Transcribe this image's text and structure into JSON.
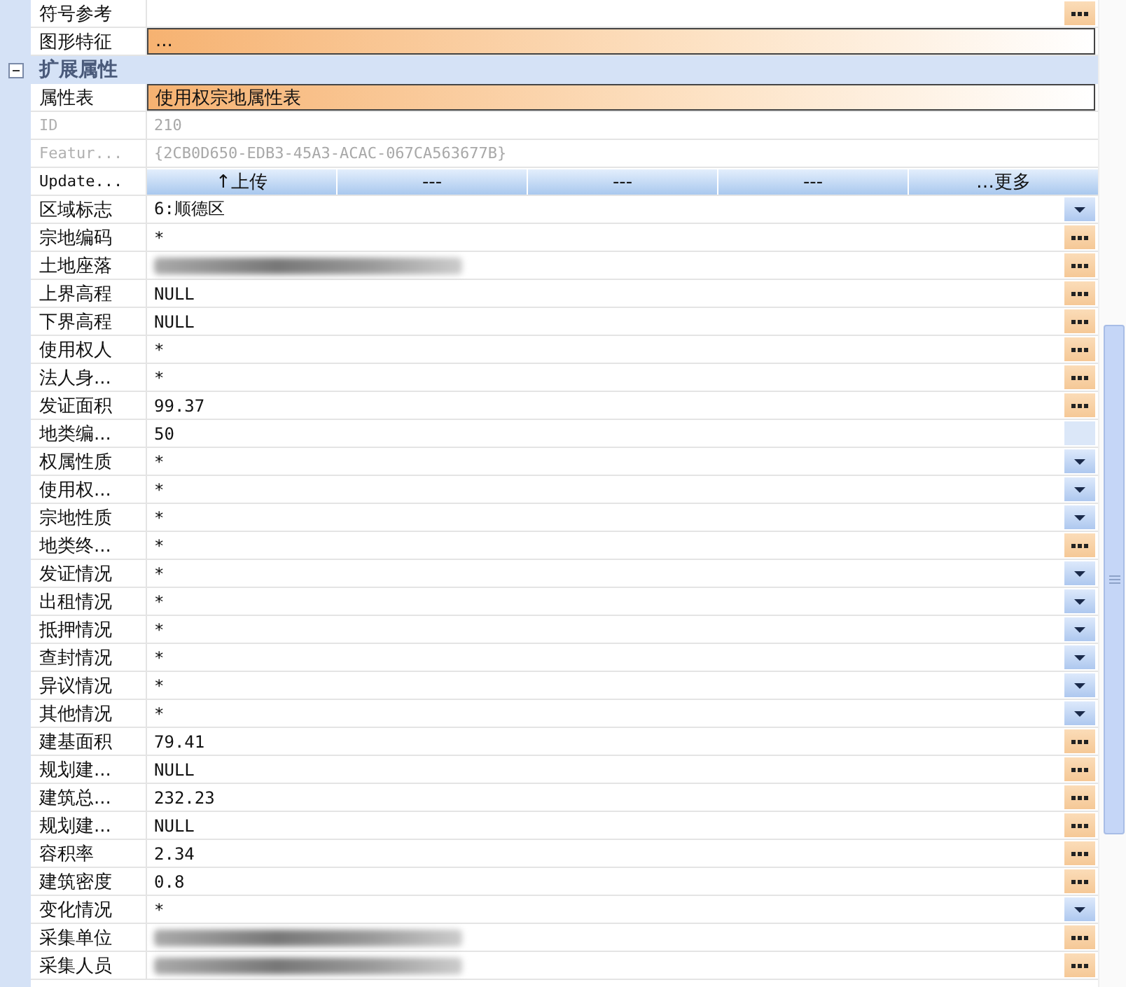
{
  "rows": [
    {
      "kind": "property",
      "name": "符号参考",
      "button": {
        "kind": "ellipsis"
      },
      "selected": false,
      "disabled": false
    },
    {
      "kind": "property",
      "name": "图形特征",
      "value": "...",
      "selected": true,
      "disabled": false
    },
    {
      "kind": "category",
      "name": "扩展属性",
      "expanded": true
    },
    {
      "kind": "property",
      "name": "属性表",
      "value": "使用权宗地属性表",
      "selected": true,
      "disabled": false
    },
    {
      "kind": "property",
      "name": "ID",
      "value": "210",
      "selected": false,
      "disabled": true
    },
    {
      "kind": "property",
      "name": "Featur...",
      "value": "{2CB0D650-EDB3-45A3-ACAC-067CA563677B}",
      "selected": false,
      "disabled": true
    },
    {
      "kind": "buttons",
      "name": "Update...",
      "buttons": [
        "↑上传",
        "---",
        "---",
        "---",
        "…更多"
      ]
    },
    {
      "kind": "property",
      "name": "区域标志",
      "value": "6:顺德区",
      "button": {
        "kind": "dropdown"
      },
      "selected": false,
      "disabled": false
    },
    {
      "kind": "property",
      "name": "宗地编码",
      "value": "*",
      "button": {
        "kind": "ellipsis"
      },
      "selected": false,
      "disabled": false
    },
    {
      "kind": "property",
      "name": "土地座落",
      "redacted": true,
      "button": {
        "kind": "ellipsis"
      },
      "selected": false,
      "disabled": false
    },
    {
      "kind": "property",
      "name": "上界高程",
      "value": "NULL",
      "button": {
        "kind": "ellipsis"
      },
      "selected": false,
      "disabled": false
    },
    {
      "kind": "property",
      "name": "下界高程",
      "value": "NULL",
      "button": {
        "kind": "ellipsis"
      },
      "selected": false,
      "disabled": false
    },
    {
      "kind": "property",
      "name": "使用权人",
      "value": "*",
      "button": {
        "kind": "ellipsis"
      },
      "selected": false,
      "disabled": false
    },
    {
      "kind": "property",
      "name": "法人身...",
      "value": "*",
      "button": {
        "kind": "ellipsis"
      },
      "selected": false,
      "disabled": false
    },
    {
      "kind": "property",
      "name": "发证面积",
      "value": "99.37",
      "button": {
        "kind": "ellipsis"
      },
      "selected": false,
      "disabled": false
    },
    {
      "kind": "property",
      "name": "地类编...",
      "value": "50",
      "button": {
        "kind": "blank"
      },
      "selected": false,
      "disabled": false
    },
    {
      "kind": "property",
      "name": "权属性质",
      "value": "*",
      "button": {
        "kind": "dropdown"
      },
      "selected": false,
      "disabled": false
    },
    {
      "kind": "property",
      "name": "使用权...",
      "value": "*",
      "button": {
        "kind": "dropdown"
      },
      "selected": false,
      "disabled": false
    },
    {
      "kind": "property",
      "name": "宗地性质",
      "value": "*",
      "button": {
        "kind": "dropdown"
      },
      "selected": false,
      "disabled": false
    },
    {
      "kind": "property",
      "name": "地类终...",
      "value": "*",
      "button": {
        "kind": "ellipsis"
      },
      "selected": false,
      "disabled": false
    },
    {
      "kind": "property",
      "name": "发证情况",
      "value": "*",
      "button": {
        "kind": "dropdown"
      },
      "selected": false,
      "disabled": false
    },
    {
      "kind": "property",
      "name": "出租情况",
      "value": "*",
      "button": {
        "kind": "dropdown"
      },
      "selected": false,
      "disabled": false
    },
    {
      "kind": "property",
      "name": "抵押情况",
      "value": "*",
      "button": {
        "kind": "dropdown"
      },
      "selected": false,
      "disabled": false
    },
    {
      "kind": "property",
      "name": "查封情况",
      "value": "*",
      "button": {
        "kind": "dropdown"
      },
      "selected": false,
      "disabled": false
    },
    {
      "kind": "property",
      "name": "异议情况",
      "value": "*",
      "button": {
        "kind": "dropdown"
      },
      "selected": false,
      "disabled": false
    },
    {
      "kind": "property",
      "name": "其他情况",
      "value": "*",
      "button": {
        "kind": "dropdown"
      },
      "selected": false,
      "disabled": false
    },
    {
      "kind": "property",
      "name": "建基面积",
      "value": "79.41",
      "button": {
        "kind": "ellipsis"
      },
      "selected": false,
      "disabled": false
    },
    {
      "kind": "property",
      "name": "规划建...",
      "value": "NULL",
      "button": {
        "kind": "ellipsis"
      },
      "selected": false,
      "disabled": false
    },
    {
      "kind": "property",
      "name": "建筑总...",
      "value": "232.23",
      "button": {
        "kind": "ellipsis"
      },
      "selected": false,
      "disabled": false
    },
    {
      "kind": "property",
      "name": "规划建...",
      "value": "NULL",
      "button": {
        "kind": "ellipsis"
      },
      "selected": false,
      "disabled": false
    },
    {
      "kind": "property",
      "name": "容积率",
      "value": "2.34",
      "button": {
        "kind": "ellipsis"
      },
      "selected": false,
      "disabled": false
    },
    {
      "kind": "property",
      "name": "建筑密度",
      "value": "0.8",
      "button": {
        "kind": "ellipsis"
      },
      "selected": false,
      "disabled": false
    },
    {
      "kind": "property",
      "name": "变化情况",
      "value": "*",
      "button": {
        "kind": "dropdown"
      },
      "selected": false,
      "disabled": false
    },
    {
      "kind": "property",
      "name": "采集单位",
      "redacted": true,
      "button": {
        "kind": "ellipsis"
      },
      "selected": false,
      "disabled": false
    },
    {
      "kind": "property",
      "name": "采集人员",
      "redacted": true,
      "button": {
        "kind": "ellipsis"
      },
      "selected": false,
      "disabled": false
    }
  ]
}
